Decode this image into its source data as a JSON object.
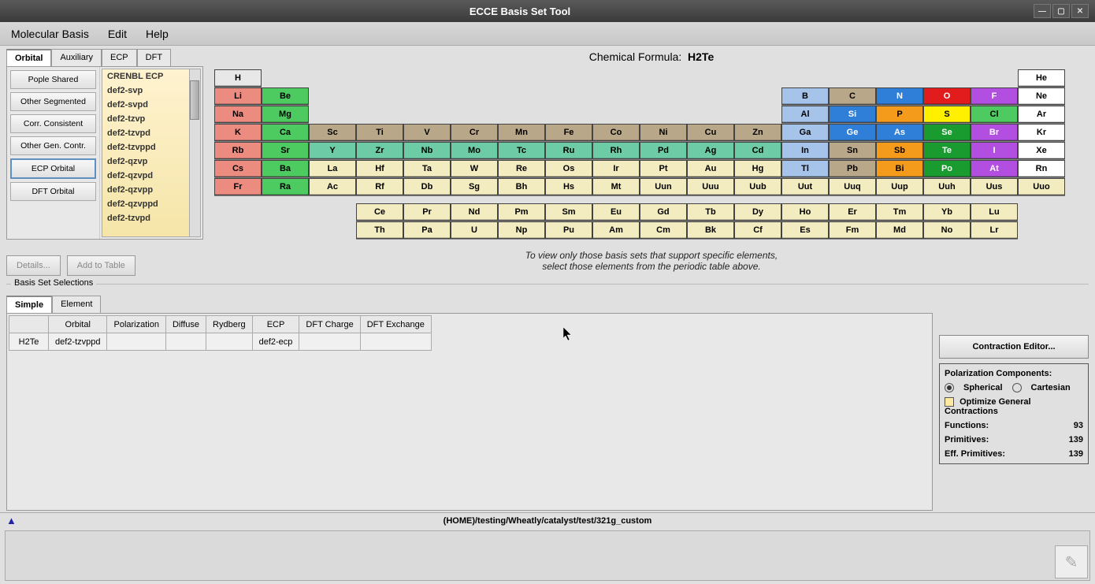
{
  "window": {
    "title": "ECCE Basis Set Tool"
  },
  "menu": {
    "items": [
      "Molecular Basis",
      "Edit",
      "Help"
    ]
  },
  "leftTabs": [
    "Orbital",
    "Auxiliary",
    "ECP",
    "DFT"
  ],
  "categories": [
    "Pople Shared",
    "Other Segmented",
    "Corr. Consistent",
    "Other Gen. Contr.",
    "ECP Orbital",
    "DFT Orbital"
  ],
  "activeCategory": 4,
  "basisList": [
    "CRENBL ECP",
    "def2-svp",
    "def2-svpd",
    "def2-tzvp",
    "def2-tzvpd",
    "def2-tzvppd",
    "def2-qzvp",
    "def2-qzvpd",
    "def2-qzvpp",
    "def2-qzvppd",
    "def2-tzvpd"
  ],
  "buttons": {
    "details": "Details...",
    "addToTable": "Add to Table",
    "contractionEditor": "Contraction Editor..."
  },
  "formula": {
    "label": "Chemical Formula:",
    "value": "H2Te"
  },
  "helpText1": "To view only those basis sets that support specific elements,",
  "helpText2": "select those elements from the periodic table above.",
  "sectionLabel": "Basis Set Selections",
  "selTabs": [
    "Simple",
    "Element"
  ],
  "selTable": {
    "headers": [
      "",
      "Orbital",
      "Polarization",
      "Diffuse",
      "Rydberg",
      "ECP",
      "DFT Charge",
      "DFT Exchange"
    ],
    "row": {
      "name": "H2Te",
      "orbital": "def2-tzvppd",
      "polarization": "",
      "diffuse": "",
      "rydberg": "",
      "ecp": "def2-ecp",
      "dftcharge": "",
      "dftexchange": ""
    }
  },
  "polBox": {
    "title": "Polarization Components:",
    "opt1": "Spherical",
    "opt2": "Cartesian",
    "optimize": "Optimize General Contractions",
    "stats": {
      "functions_l": "Functions:",
      "functions_v": "93",
      "prim_l": "Primitives:",
      "prim_v": "139",
      "eff_l": "Eff. Primitives:",
      "eff_v": "139"
    }
  },
  "path": "(HOME)/testing/Wheatly/catalyst/test/321g_custom",
  "ptable": {
    "row1": [
      {
        "s": "H",
        "c": "c-gray"
      },
      null,
      null,
      null,
      null,
      null,
      null,
      null,
      null,
      null,
      null,
      null,
      null,
      null,
      null,
      null,
      null,
      {
        "s": "He",
        "c": "c-white"
      }
    ],
    "row2": [
      {
        "s": "Li",
        "c": "c-salmon"
      },
      {
        "s": "Be",
        "c": "c-green1"
      },
      null,
      null,
      null,
      null,
      null,
      null,
      null,
      null,
      null,
      null,
      {
        "s": "B",
        "c": "c-ltblue"
      },
      {
        "s": "C",
        "c": "c-tan"
      },
      {
        "s": "N",
        "c": "c-blue"
      },
      {
        "s": "O",
        "c": "c-red"
      },
      {
        "s": "F",
        "c": "c-purple"
      },
      {
        "s": "Ne",
        "c": "c-white"
      }
    ],
    "row3": [
      {
        "s": "Na",
        "c": "c-salmon"
      },
      {
        "s": "Mg",
        "c": "c-green1"
      },
      null,
      null,
      null,
      null,
      null,
      null,
      null,
      null,
      null,
      null,
      {
        "s": "Al",
        "c": "c-ltblue"
      },
      {
        "s": "Si",
        "c": "c-blue"
      },
      {
        "s": "P",
        "c": "c-orange"
      },
      {
        "s": "S",
        "c": "c-yellow"
      },
      {
        "s": "Cl",
        "c": "c-green1"
      },
      {
        "s": "Ar",
        "c": "c-white"
      }
    ],
    "row4": [
      {
        "s": "K",
        "c": "c-salmon"
      },
      {
        "s": "Ca",
        "c": "c-green1"
      },
      {
        "s": "Sc",
        "c": "c-tan"
      },
      {
        "s": "Ti",
        "c": "c-tan"
      },
      {
        "s": "V",
        "c": "c-tan"
      },
      {
        "s": "Cr",
        "c": "c-tan"
      },
      {
        "s": "Mn",
        "c": "c-tan"
      },
      {
        "s": "Fe",
        "c": "c-tan"
      },
      {
        "s": "Co",
        "c": "c-tan"
      },
      {
        "s": "Ni",
        "c": "c-tan"
      },
      {
        "s": "Cu",
        "c": "c-tan"
      },
      {
        "s": "Zn",
        "c": "c-tan"
      },
      {
        "s": "Ga",
        "c": "c-ltblue"
      },
      {
        "s": "Ge",
        "c": "c-blue"
      },
      {
        "s": "As",
        "c": "c-blue"
      },
      {
        "s": "Se",
        "c": "c-dgreen"
      },
      {
        "s": "Br",
        "c": "c-purple"
      },
      {
        "s": "Kr",
        "c": "c-white"
      }
    ],
    "row5": [
      {
        "s": "Rb",
        "c": "c-salmon"
      },
      {
        "s": "Sr",
        "c": "c-green1"
      },
      {
        "s": "Y",
        "c": "c-teal"
      },
      {
        "s": "Zr",
        "c": "c-teal"
      },
      {
        "s": "Nb",
        "c": "c-teal"
      },
      {
        "s": "Mo",
        "c": "c-teal"
      },
      {
        "s": "Tc",
        "c": "c-teal"
      },
      {
        "s": "Ru",
        "c": "c-teal"
      },
      {
        "s": "Rh",
        "c": "c-teal"
      },
      {
        "s": "Pd",
        "c": "c-teal"
      },
      {
        "s": "Ag",
        "c": "c-teal"
      },
      {
        "s": "Cd",
        "c": "c-teal"
      },
      {
        "s": "In",
        "c": "c-ltblue"
      },
      {
        "s": "Sn",
        "c": "c-tan"
      },
      {
        "s": "Sb",
        "c": "c-orange"
      },
      {
        "s": "Te",
        "c": "c-dgreen"
      },
      {
        "s": "I",
        "c": "c-purple"
      },
      {
        "s": "Xe",
        "c": "c-white"
      }
    ],
    "row6": [
      {
        "s": "Cs",
        "c": "c-salmon"
      },
      {
        "s": "Ba",
        "c": "c-green1"
      },
      {
        "s": "La",
        "c": "c-paleyellow"
      },
      {
        "s": "Hf",
        "c": "c-paleyellow"
      },
      {
        "s": "Ta",
        "c": "c-paleyellow"
      },
      {
        "s": "W",
        "c": "c-paleyellow"
      },
      {
        "s": "Re",
        "c": "c-paleyellow"
      },
      {
        "s": "Os",
        "c": "c-paleyellow"
      },
      {
        "s": "Ir",
        "c": "c-paleyellow"
      },
      {
        "s": "Pt",
        "c": "c-paleyellow"
      },
      {
        "s": "Au",
        "c": "c-paleyellow"
      },
      {
        "s": "Hg",
        "c": "c-paleyellow"
      },
      {
        "s": "Tl",
        "c": "c-ltblue"
      },
      {
        "s": "Pb",
        "c": "c-tan"
      },
      {
        "s": "Bi",
        "c": "c-orange"
      },
      {
        "s": "Po",
        "c": "c-dgreen"
      },
      {
        "s": "At",
        "c": "c-purple"
      },
      {
        "s": "Rn",
        "c": "c-white"
      }
    ],
    "row7": [
      {
        "s": "Fr",
        "c": "c-salmon"
      },
      {
        "s": "Ra",
        "c": "c-green1"
      },
      {
        "s": "Ac",
        "c": "c-paleyellow"
      },
      {
        "s": "Rf",
        "c": "c-paleyellow"
      },
      {
        "s": "Db",
        "c": "c-paleyellow"
      },
      {
        "s": "Sg",
        "c": "c-paleyellow"
      },
      {
        "s": "Bh",
        "c": "c-paleyellow"
      },
      {
        "s": "Hs",
        "c": "c-paleyellow"
      },
      {
        "s": "Mt",
        "c": "c-paleyellow"
      },
      {
        "s": "Uun",
        "c": "c-paleyellow"
      },
      {
        "s": "Uuu",
        "c": "c-paleyellow"
      },
      {
        "s": "Uub",
        "c": "c-paleyellow"
      },
      {
        "s": "Uut",
        "c": "c-paleyellow"
      },
      {
        "s": "Uuq",
        "c": "c-paleyellow"
      },
      {
        "s": "Uup",
        "c": "c-paleyellow"
      },
      {
        "s": "Uuh",
        "c": "c-paleyellow"
      },
      {
        "s": "Uus",
        "c": "c-paleyellow"
      },
      {
        "s": "Uuo",
        "c": "c-paleyellow"
      }
    ],
    "lan": [
      {
        "s": "Ce"
      },
      {
        "s": "Pr"
      },
      {
        "s": "Nd"
      },
      {
        "s": "Pm"
      },
      {
        "s": "Sm"
      },
      {
        "s": "Eu"
      },
      {
        "s": "Gd"
      },
      {
        "s": "Tb"
      },
      {
        "s": "Dy"
      },
      {
        "s": "Ho"
      },
      {
        "s": "Er"
      },
      {
        "s": "Tm"
      },
      {
        "s": "Yb"
      },
      {
        "s": "Lu"
      }
    ],
    "act": [
      {
        "s": "Th"
      },
      {
        "s": "Pa"
      },
      {
        "s": "U"
      },
      {
        "s": "Np"
      },
      {
        "s": "Pu"
      },
      {
        "s": "Am"
      },
      {
        "s": "Cm"
      },
      {
        "s": "Bk"
      },
      {
        "s": "Cf"
      },
      {
        "s": "Es"
      },
      {
        "s": "Fm"
      },
      {
        "s": "Md"
      },
      {
        "s": "No"
      },
      {
        "s": "Lr"
      }
    ]
  }
}
